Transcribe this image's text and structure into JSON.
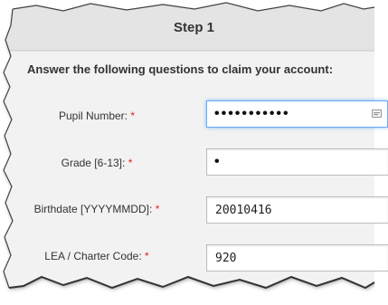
{
  "form": {
    "step_title": "Step 1",
    "instructions": "Answer the following questions to claim your account:",
    "required_marker": "*",
    "fields": [
      {
        "label": "Pupil Number:",
        "value": "•••••••••••",
        "type": "password"
      },
      {
        "label": "Grade [6-13]:",
        "value": "•",
        "type": "password"
      },
      {
        "label": "Birthdate [YYYYMMDD]:",
        "value": "20010416",
        "type": "text"
      },
      {
        "label": "LEA / Charter Code:",
        "value": "920",
        "type": "text"
      }
    ]
  },
  "colors": {
    "header_bg": "#e4e4e4",
    "form_bg": "#f2f2f2",
    "required": "#e0261e",
    "focus_border": "#66aaff"
  },
  "icons": [
    "password-manager-icon"
  ]
}
